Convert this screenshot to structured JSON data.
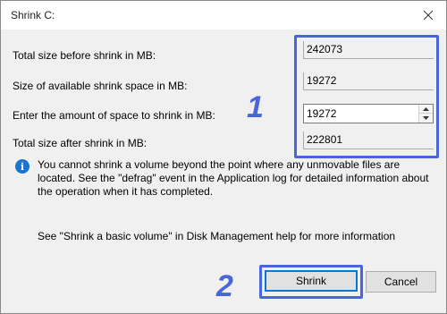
{
  "window": {
    "title": "Shrink C:",
    "close_icon": "close-icon"
  },
  "fields": {
    "total_before_label": "Total size before shrink in MB:",
    "total_before_value": "242073",
    "available_label": "Size of available shrink space in MB:",
    "available_value": "19272",
    "amount_label": "Enter the amount of space to shrink in MB:",
    "amount_value": "19272",
    "total_after_label": "Total size after shrink in MB:",
    "total_after_value": "222801"
  },
  "info": {
    "icon": "info-icon",
    "text": "You cannot shrink a volume beyond the point where any unmovable files are located. See the \"defrag\" event in the Application log for detailed information about the operation when it has completed.",
    "help": "See \"Shrink a basic volume\" in Disk Management help for more information"
  },
  "buttons": {
    "shrink": "Shrink",
    "cancel": "Cancel"
  },
  "annotations": {
    "step1": "1",
    "step2": "2",
    "accent_color": "#4866d9"
  }
}
